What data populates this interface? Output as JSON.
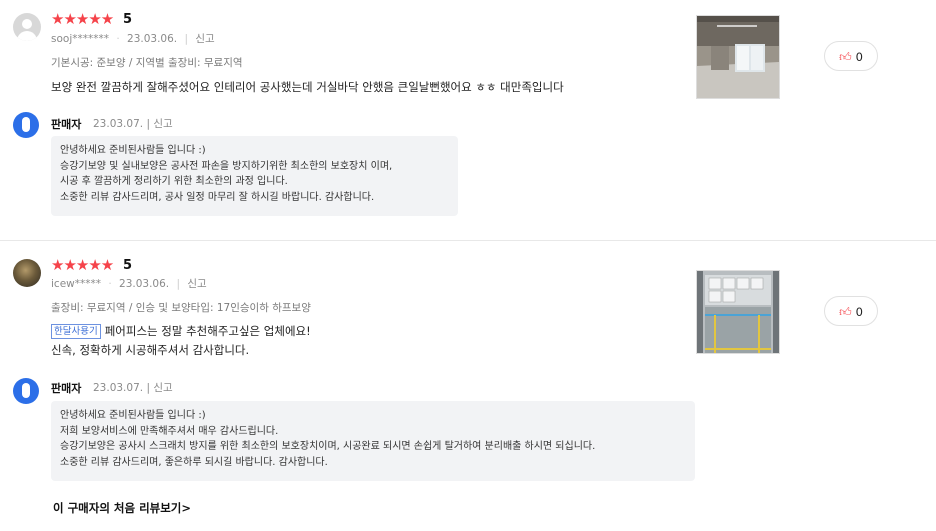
{
  "reviews": [
    {
      "rating": "5",
      "stars": "★★★★★",
      "user": "sooj*******",
      "date": "23.03.06.",
      "report": "신고",
      "options": "기본시공: 준보양 / 지역별 출장비: 무료지역",
      "badge": "",
      "lines": [
        "보양 완전 깔끔하게 잘해주셨어요 인테리어 공사했는데 거실바닥 안했음 큰일날뻔했어요 ㅎㅎ 대만족입니다"
      ],
      "likes": "0",
      "seller": {
        "name": "판매자",
        "date": "23.03.07.",
        "report": "신고",
        "lines": [
          "안녕하세요 준비된사람들 입니다 :)",
          "승강기보양 및 실내보양은 공사전 파손을 방지하기위한 최소한의 보호장치 이며,",
          "시공 후 깔끔하게 정리하기 위한 최소한의 과정 입니다.",
          "소중한 리뷰 감사드리며, 공사 일정 마무리 잘 하시길 바랍니다. 감사합니다."
        ]
      }
    },
    {
      "rating": "5",
      "stars": "★★★★★",
      "user": "icew*****",
      "date": "23.03.06.",
      "report": "신고",
      "options": "출장비: 무료지역 / 인승 및 보양타입: 17인승이하 하프보양",
      "badge": "한달사용기",
      "lines": [
        "페어피스는 정말 추천해주고싶은 업체에요!",
        "신속, 정확하게 시공해주셔서 감사합니다."
      ],
      "likes": "0",
      "seller": {
        "name": "판매자",
        "date": "23.03.07.",
        "report": "신고",
        "lines": [
          "안녕하세요 준비된사람들 입니다 :)",
          "저희 보양서비스에 만족해주셔서 매우 감사드립니다.",
          "승강기보양은 공사시 스크래치 방지를 위한 최소한의 보호장치이며, 시공완료 되시면 손쉽게 탈거하여 분리배출 하시면 되십니다.",
          "소중한 리뷰 감사드리며, 좋은하루 되시길 바랍니다. 감사합니다."
        ]
      }
    }
  ],
  "more_link": "이 구매자의 처음 리뷰보기",
  "more_link_arrow": ">"
}
